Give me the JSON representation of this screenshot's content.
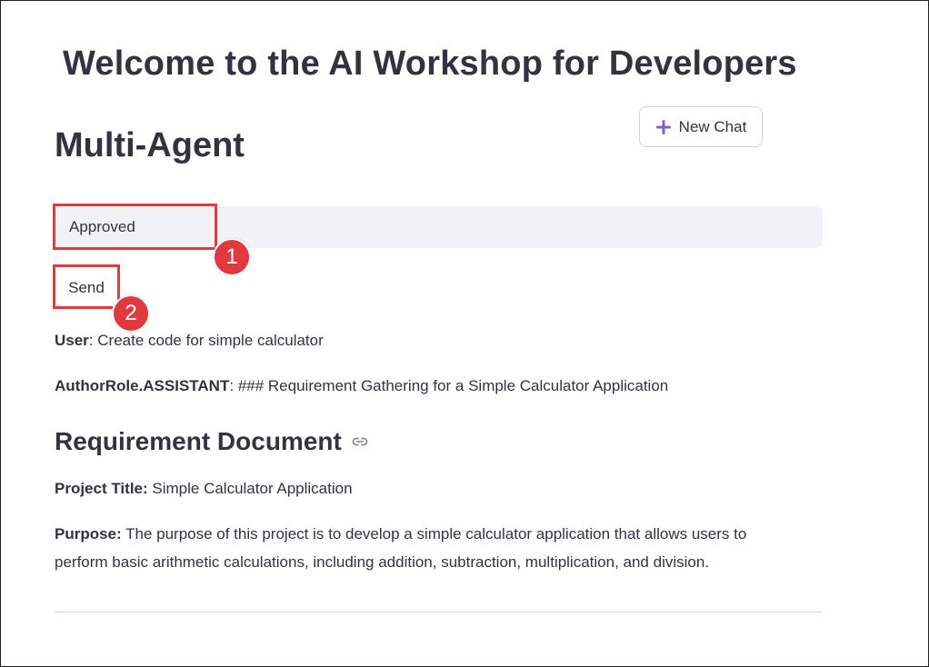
{
  "app": {
    "title": "Welcome to the AI Workshop for Developers"
  },
  "page": {
    "section_title": "Multi-Agent"
  },
  "toolbar": {
    "new_chat_label": "New Chat",
    "new_chat_icon": "plus-icon",
    "accent_color": "#7b61c9"
  },
  "chat_input": {
    "value": "Approved",
    "placeholder": ""
  },
  "send_button": {
    "label": "Send"
  },
  "annotations": {
    "callout_1": "1",
    "callout_2": "2",
    "color": "#e0393e"
  },
  "messages": [
    {
      "author": "User",
      "separator": ":",
      "text": " Create code for simple calculator"
    },
    {
      "author": "AuthorRole.ASSISTANT",
      "separator": ":",
      "text": " ### Requirement Gathering for a Simple Calculator Application"
    }
  ],
  "document": {
    "heading": "Requirement Document",
    "heading_icon": "link-icon",
    "project_title_label": "Project Title:",
    "project_title_value": " Simple Calculator Application",
    "purpose_label": "Purpose:",
    "purpose_line1": " The purpose of this project is to develop a simple calculator application that allows users to",
    "purpose_line2": "perform basic arithmetic calculations, including addition, subtraction, multiplication, and division."
  }
}
